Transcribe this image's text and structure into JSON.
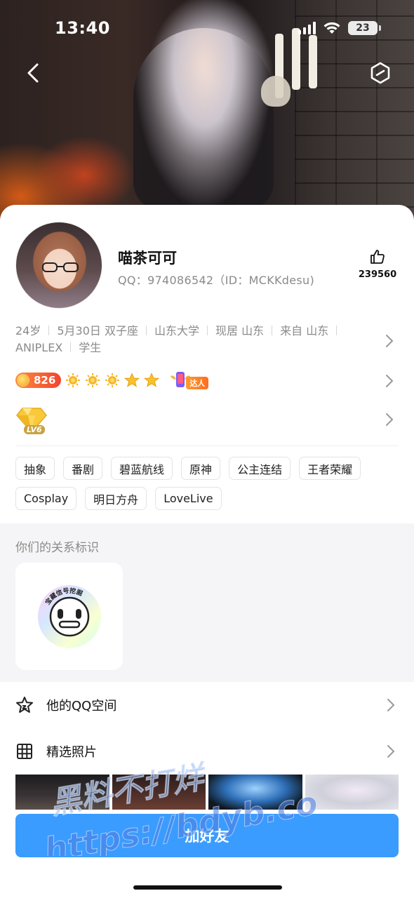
{
  "status_bar": {
    "time": "13:40",
    "battery": "23"
  },
  "profile": {
    "name": "喵茶可可",
    "qq_line": "QQ：974086542（ID：MCKKdesu)",
    "likes": "239560"
  },
  "info": [
    "24岁",
    "5月30日 双子座",
    "山东大学",
    "现居 山东",
    "来自 山东",
    "ANIPLEX",
    "学生"
  ],
  "badges": {
    "coins": "826",
    "expert_label": "达人",
    "level_label": "LV6"
  },
  "tags": [
    "抽象",
    "番剧",
    "碧蓝航线",
    "原神",
    "公主连结",
    "王者荣耀",
    "Cosplay",
    "明日方舟",
    "LoveLive"
  ],
  "relation": {
    "title": "你们的关系标识",
    "badge_text": "宝藏信号挖掘"
  },
  "list": {
    "qzone": "他的QQ空间",
    "photos": "精选照片"
  },
  "add_friend": "加好友",
  "watermark": {
    "line1": "黑料不打烊",
    "line2": "https://bdyb.co"
  },
  "colors": {
    "primary_button": "#3a9cff",
    "coin_badge": "#f0452e"
  }
}
